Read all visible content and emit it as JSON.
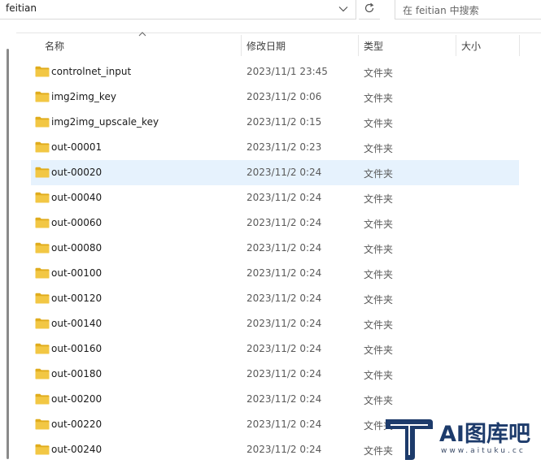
{
  "address": {
    "path": "feitian"
  },
  "search": {
    "placeholder": "在 feitian 中搜索"
  },
  "columns": {
    "name": "名称",
    "date": "修改日期",
    "type": "类型",
    "size": "大小"
  },
  "rows": [
    {
      "name": "controlnet_input",
      "date": "2023/11/1 23:45",
      "type": "文件夹"
    },
    {
      "name": "img2img_key",
      "date": "2023/11/2 0:06",
      "type": "文件夹"
    },
    {
      "name": "img2img_upscale_key",
      "date": "2023/11/2 0:15",
      "type": "文件夹"
    },
    {
      "name": "out-00001",
      "date": "2023/11/2 0:23",
      "type": "文件夹"
    },
    {
      "name": "out-00020",
      "date": "2023/11/2 0:24",
      "type": "文件夹"
    },
    {
      "name": "out-00040",
      "date": "2023/11/2 0:24",
      "type": "文件夹"
    },
    {
      "name": "out-00060",
      "date": "2023/11/2 0:24",
      "type": "文件夹"
    },
    {
      "name": "out-00080",
      "date": "2023/11/2 0:24",
      "type": "文件夹"
    },
    {
      "name": "out-00100",
      "date": "2023/11/2 0:24",
      "type": "文件夹"
    },
    {
      "name": "out-00120",
      "date": "2023/11/2 0:24",
      "type": "文件夹"
    },
    {
      "name": "out-00140",
      "date": "2023/11/2 0:24",
      "type": "文件夹"
    },
    {
      "name": "out-00160",
      "date": "2023/11/2 0:24",
      "type": "文件夹"
    },
    {
      "name": "out-00180",
      "date": "2023/11/2 0:24",
      "type": "文件夹"
    },
    {
      "name": "out-00200",
      "date": "2023/11/2 0:24",
      "type": "文件夹"
    },
    {
      "name": "out-00220",
      "date": "2023/11/2 0:24",
      "type": "文件夹"
    },
    {
      "name": "out-00240",
      "date": "2023/11/2 0:24",
      "type": "文件夹"
    }
  ],
  "selected_row": "out-00020",
  "watermark": {
    "title": "AI图库吧",
    "subtitle": "www.aituku.cc"
  },
  "colors": {
    "folder": "#f2c744",
    "folder_dark": "#e0ac1c",
    "selected_bg": "#e6f2fd",
    "watermark": "#1d3b6b"
  }
}
